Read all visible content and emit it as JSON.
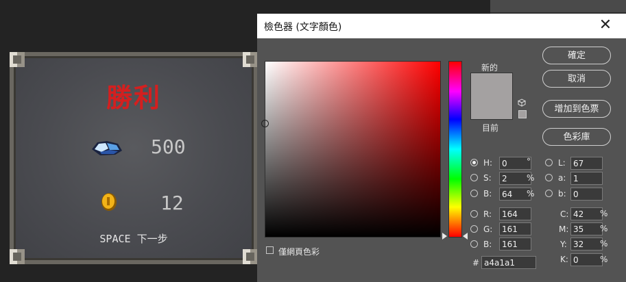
{
  "game": {
    "title": "勝利",
    "gem_count": "500",
    "coin_count": "12",
    "hint": "SPACE 下一步"
  },
  "dialog": {
    "title": "檢色器 (文字顏色)",
    "close": "✕",
    "new_label": "新的",
    "current_label": "目前",
    "web_only_label": "僅網頁色彩",
    "buttons": {
      "ok": "確定",
      "cancel": "取消",
      "add_swatch": "增加到色票",
      "libraries": "色彩庫"
    },
    "hsb": {
      "h_label": "H:",
      "h_value": "0",
      "h_unit": "°",
      "s_label": "S:",
      "s_value": "2",
      "s_unit": "%",
      "b_label": "B:",
      "b_value": "64",
      "b_unit": "%"
    },
    "rgb": {
      "r_label": "R:",
      "r_value": "164",
      "g_label": "G:",
      "g_value": "161",
      "b_label": "B:",
      "b_value": "161"
    },
    "lab": {
      "l_label": "L:",
      "l_value": "67",
      "a_label": "a:",
      "a_value": "1",
      "b_label": "b:",
      "b_value": "0"
    },
    "cmyk": {
      "c_label": "C:",
      "c_value": "42",
      "m_label": "M:",
      "m_value": "35",
      "y_label": "Y:",
      "y_value": "32",
      "k_label": "K:",
      "k_value": "0",
      "unit": "%"
    },
    "hex_label": "#",
    "hex_value": "a4a1a1",
    "selected_color": "#a4a1a1"
  }
}
